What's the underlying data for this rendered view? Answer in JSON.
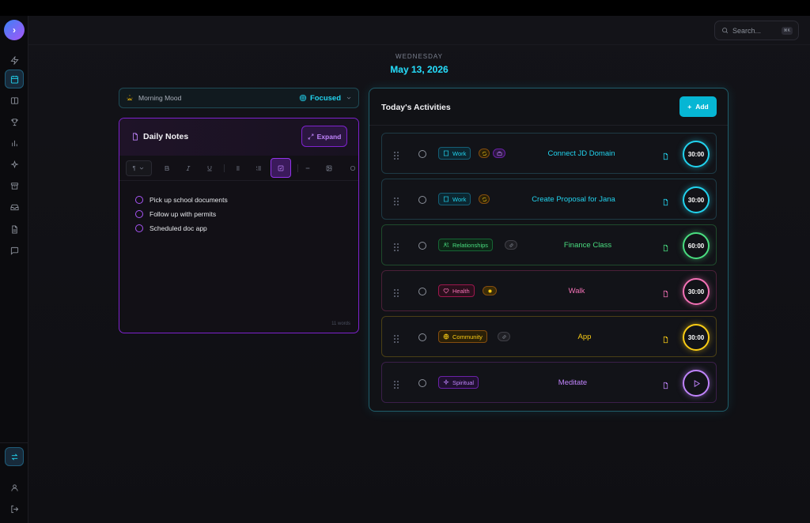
{
  "header": {
    "search_placeholder": "Search...",
    "search_shortcut": "⌘K",
    "weekday": "WEDNESDAY",
    "date": "May 13, 2026"
  },
  "mood": {
    "label": "Morning Mood",
    "value": "Focused"
  },
  "notes": {
    "title": "Daily Notes",
    "expand_label": "Expand",
    "paragraph_select": "¶",
    "todos": [
      "Pick up school documents",
      "Follow up with permits",
      "Scheduled doc app"
    ],
    "word_count": "11 words"
  },
  "activities": {
    "title": "Today's Activities",
    "add_label": "Add",
    "items": [
      {
        "category": "Work",
        "title": "Connect JD Domain",
        "timer": "30:00",
        "color": "#22d3ee"
      },
      {
        "category": "Work",
        "title": "Create Proposal for Jana",
        "timer": "30:00",
        "color": "#22d3ee"
      },
      {
        "category": "Relationships",
        "title": "Finance Class",
        "timer": "60:00",
        "color": "#4ade80"
      },
      {
        "category": "Health",
        "title": "Walk",
        "timer": "30:00",
        "color": "#f472b6"
      },
      {
        "category": "Community",
        "title": "App",
        "timer": "30:00",
        "color": "#facc15"
      },
      {
        "category": "Spiritual",
        "title": "Meditate",
        "timer": "",
        "color": "#c084fc"
      }
    ]
  },
  "colors": {
    "accent": "#22d3ee",
    "purple": "#a855f7",
    "background": "#0f0f12"
  }
}
